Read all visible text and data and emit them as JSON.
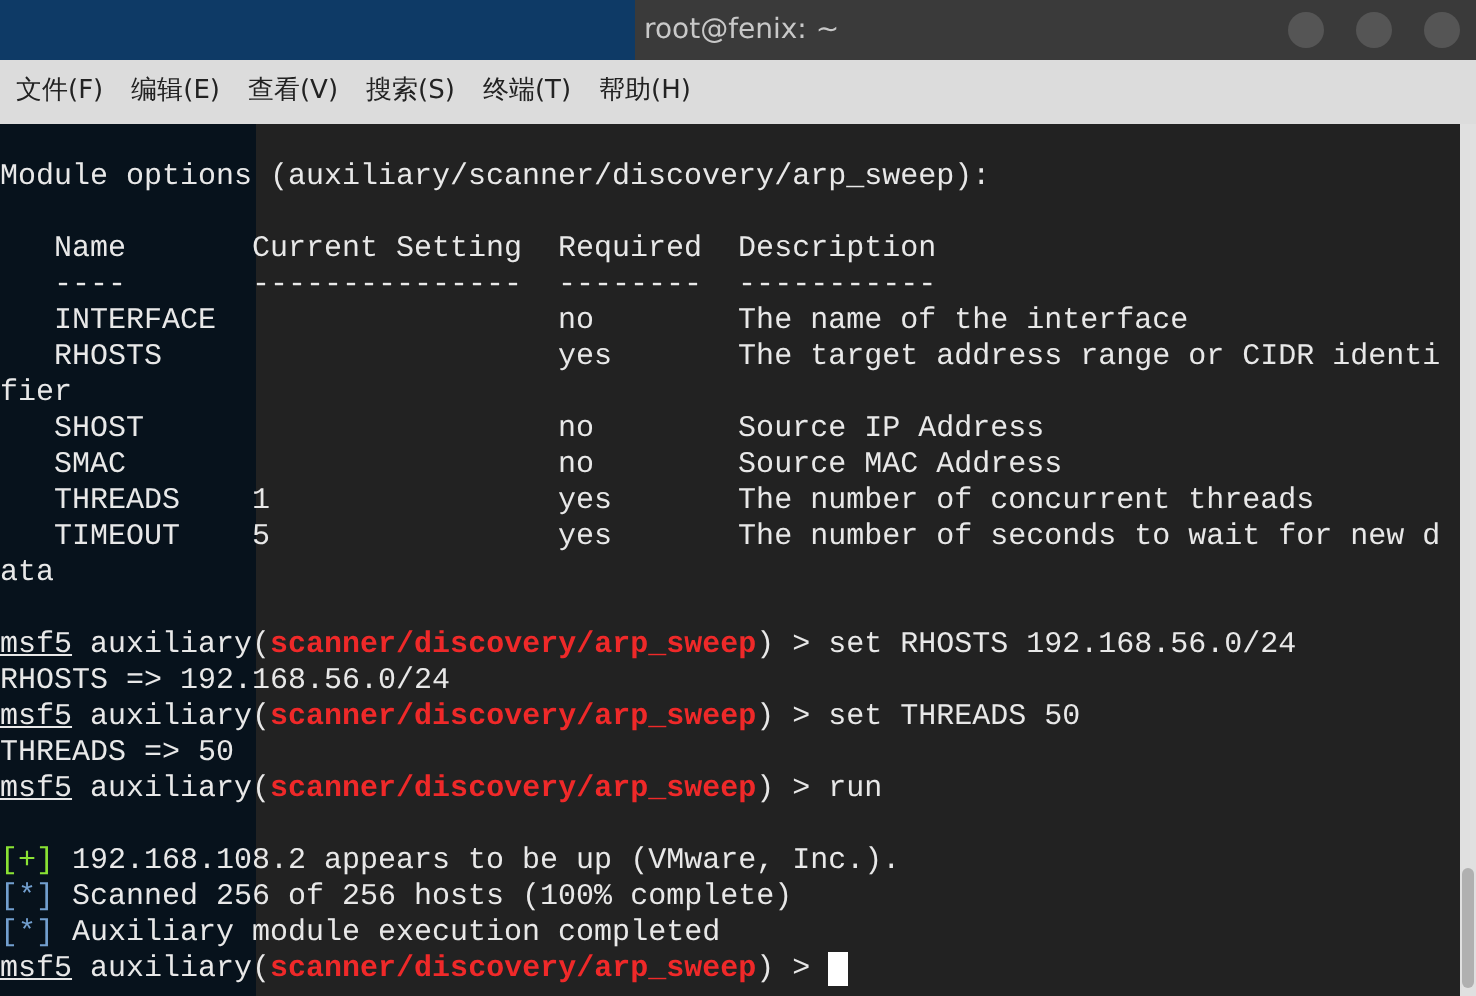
{
  "window": {
    "title": "root@fenix: ~"
  },
  "menu": [
    "文件(F)",
    "编辑(E)",
    "查看(V)",
    "搜索(S)",
    "终端(T)",
    "帮助(H)"
  ],
  "lines": [
    {
      "kind": "blank"
    },
    {
      "kind": "plain",
      "text": "Module options (auxiliary/scanner/discovery/arp_sweep):"
    },
    {
      "kind": "blank"
    },
    {
      "kind": "plain",
      "text": "   Name       Current Setting  Required  Description"
    },
    {
      "kind": "plain",
      "text": "   ----       ---------------  --------  -----------"
    },
    {
      "kind": "plain",
      "text": "   INTERFACE                   no        The name of the interface"
    },
    {
      "kind": "plain",
      "text": "   RHOSTS                      yes       The target address range or CIDR identi"
    },
    {
      "kind": "plain",
      "text": "fier"
    },
    {
      "kind": "plain",
      "text": "   SHOST                       no        Source IP Address"
    },
    {
      "kind": "plain",
      "text": "   SMAC                        no        Source MAC Address"
    },
    {
      "kind": "plain",
      "text": "   THREADS    1                yes       The number of concurrent threads"
    },
    {
      "kind": "plain",
      "text": "   TIMEOUT    5                yes       The number of seconds to wait for new d"
    },
    {
      "kind": "plain",
      "text": "ata"
    },
    {
      "kind": "blank"
    },
    {
      "kind": "prompt",
      "user": "msf5",
      "prefix": " auxiliary(",
      "module": "scanner/discovery/arp_sweep",
      "suffix": ") > ",
      "command": "set RHOSTS 192.168.56.0/24"
    },
    {
      "kind": "plain",
      "text": "RHOSTS => 192.168.56.0/24"
    },
    {
      "kind": "prompt",
      "user": "msf5",
      "prefix": " auxiliary(",
      "module": "scanner/discovery/arp_sweep",
      "suffix": ") > ",
      "command": "set THREADS 50"
    },
    {
      "kind": "plain",
      "text": "THREADS => 50"
    },
    {
      "kind": "prompt",
      "user": "msf5",
      "prefix": " auxiliary(",
      "module": "scanner/discovery/arp_sweep",
      "suffix": ") > ",
      "command": "run"
    },
    {
      "kind": "blank"
    },
    {
      "kind": "status",
      "marker": "[+]",
      "color": "#8ae234",
      "text": " 192.168.108.2 appears to be up (VMware, Inc.)."
    },
    {
      "kind": "status",
      "marker": "[*]",
      "color": "#729fcf",
      "text": " Scanned 256 of 256 hosts (100% complete)"
    },
    {
      "kind": "status",
      "marker": "[*]",
      "color": "#729fcf",
      "text": " Auxiliary module execution completed"
    },
    {
      "kind": "prompt",
      "user": "msf5",
      "prefix": " auxiliary(",
      "module": "scanner/discovery/arp_sweep",
      "suffix": ") > ",
      "cursor": true
    }
  ]
}
